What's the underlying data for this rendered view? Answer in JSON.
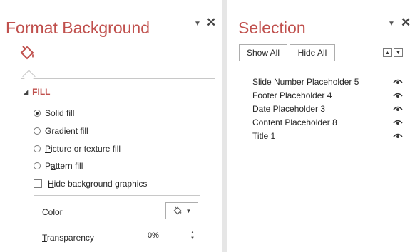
{
  "format_pane": {
    "title": "Format Background",
    "pin_glyph": "▼",
    "close_glyph": "✕",
    "tab_icon": "paint-bucket-icon",
    "section": {
      "label": "FILL",
      "expanded": true
    },
    "options": [
      {
        "pre": "",
        "key": "S",
        "rest": "olid fill",
        "selected": true
      },
      {
        "pre": "",
        "key": "G",
        "rest": "radient fill",
        "selected": false
      },
      {
        "pre": "",
        "key": "P",
        "rest": "icture or texture fill",
        "selected": false
      },
      {
        "pre": "P",
        "key": "a",
        "rest": "ttern fill",
        "selected": false
      }
    ],
    "hide_graphics": {
      "key": "H",
      "rest": "ide background graphics",
      "checked": false
    },
    "color": {
      "key": "C",
      "rest": "olor",
      "arrow": "▼"
    },
    "transparency": {
      "key": "T",
      "rest": "ransparency",
      "value": "0%",
      "level": 0
    }
  },
  "selection_pane": {
    "title": "Selection",
    "pin_glyph": "▼",
    "close_glyph": "✕",
    "show_all": "Show All",
    "hide_all": "Hide All",
    "bring_forward_glyph": "▲",
    "send_backward_glyph": "▼",
    "objects": [
      {
        "name": "Slide Number Placeholder 5",
        "visible": true
      },
      {
        "name": "Footer Placeholder 4",
        "visible": true
      },
      {
        "name": "Date Placeholder 3",
        "visible": true
      },
      {
        "name": "Content Placeholder 8",
        "visible": true
      },
      {
        "name": "Title 1",
        "visible": true
      }
    ]
  },
  "colors": {
    "accent": "#c0504d",
    "text": "#262626",
    "border": "#adadad"
  }
}
